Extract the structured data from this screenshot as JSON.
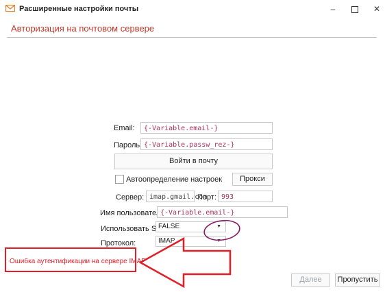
{
  "window": {
    "title": "Расширенные настройки почты",
    "icon": "envelope-icon",
    "controls": {
      "minimize": "–",
      "close": "✕"
    }
  },
  "section": {
    "title": "Авторизация на почтовом сервере"
  },
  "form": {
    "email_label": "Email:",
    "email_value": "{-Variable.email-}",
    "password_label": "Пароль:",
    "password_value": "{-Variable.passw_rez-}",
    "login_button": "Войти в почту",
    "autodetect_label": "Автоопределение настроек",
    "autodetect_checked": false,
    "proxy_button": "Прокси",
    "server_label": "Сервер:",
    "server_value": "imap.gmail.com",
    "port_label": "Порт:",
    "port_value": "993",
    "username_label": "Имя пользователя:",
    "username_value": "{-Variable.email-}",
    "ssl_label": "Использовать SSL:",
    "ssl_value": "FALSE",
    "protocol_label": "Протокол:",
    "protocol_value": "IMAP"
  },
  "error": {
    "message": "Ошибка аутентификации на сервере IMAP"
  },
  "footer": {
    "next_button": "Далее",
    "skip_button": "Пропустить"
  },
  "colors": {
    "error": "#e01f26",
    "heading": "#c0392b",
    "variable": "#a8325c",
    "annotation": "#8b1a6b"
  }
}
